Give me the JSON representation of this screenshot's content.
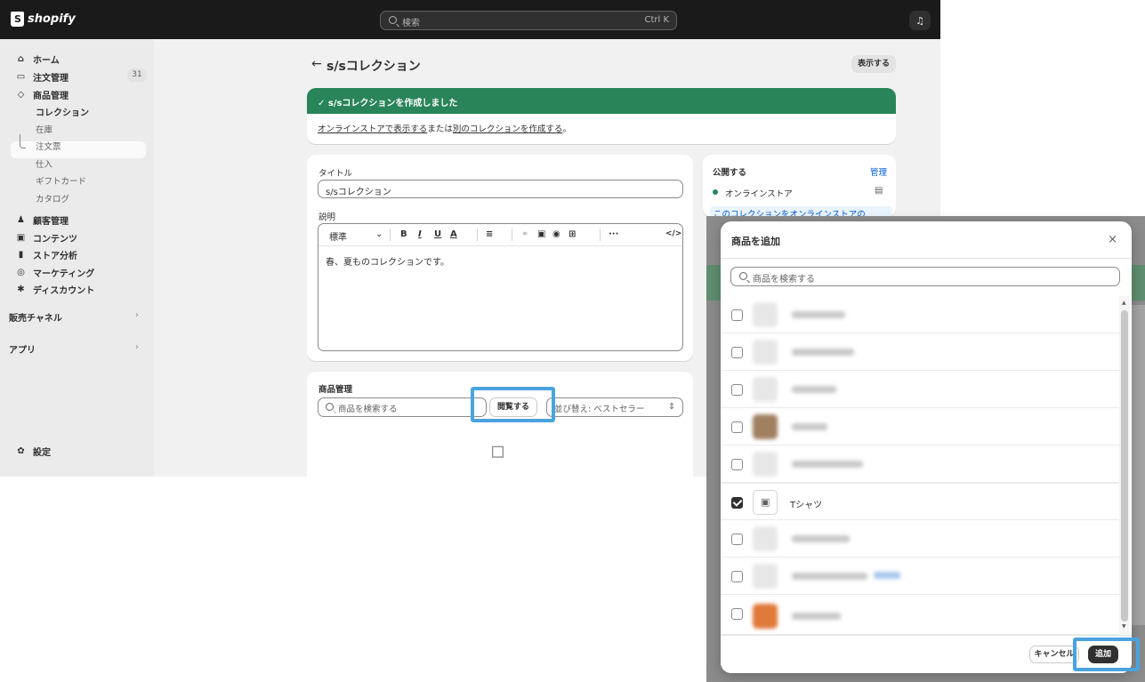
{
  "topbar": {
    "brand": "shopify",
    "search_placeholder": "検索",
    "search_shortcut": "Ctrl K"
  },
  "sidebar": {
    "items": [
      {
        "label": "ホーム",
        "icon": "home-icon"
      },
      {
        "label": "注文管理",
        "icon": "inbox-icon",
        "badge": "31"
      },
      {
        "label": "商品管理",
        "icon": "tag-icon"
      },
      {
        "label": "コレクション",
        "active": true
      }
    ],
    "sub_items": [
      "在庫",
      "注文票",
      "仕入",
      "ギフトカード",
      "カタログ"
    ],
    "more_items": [
      {
        "label": "顧客管理",
        "icon": "person-icon"
      },
      {
        "label": "コンテンツ",
        "icon": "image-icon"
      },
      {
        "label": "ストア分析",
        "icon": "bar-chart-icon"
      },
      {
        "label": "マーケティング",
        "icon": "target-icon"
      },
      {
        "label": "ディスカウント",
        "icon": "discount-icon"
      }
    ],
    "sales_channels": "販売チャネル",
    "apps": "アプリ",
    "settings": "設定"
  },
  "page": {
    "title": "s/sコレクション",
    "show_button": "表示する",
    "banner": {
      "title": "s/sコレクションを作成しました",
      "link1": "オンラインストアで表示する",
      "mid": "または",
      "link2": "別のコレクションを作成する",
      "end": "。"
    },
    "title_label": "タイトル",
    "title_value": "s/sコレクション",
    "desc_label": "説明",
    "editor_format": "標準",
    "desc_value": "春、夏ものコレクションです。",
    "products_heading": "商品管理",
    "products_search_placeholder": "商品を検索する",
    "browse_button": "閲覧する",
    "sort_label": "並び替え: ベストセラー",
    "publish": {
      "heading": "公開する",
      "manage": "管理",
      "channel": "オンラインストア",
      "notice": "このコレクションをオンラインストアの"
    }
  },
  "modal": {
    "title": "商品を追加",
    "search_placeholder": "商品を検索する",
    "selected_product": "Tシャツ",
    "cancel": "キャンセル",
    "add": "追加"
  },
  "colors": {
    "accent_green": "#29845a",
    "highlight": "#4aa3df",
    "topbar": "#1a1a1a"
  }
}
